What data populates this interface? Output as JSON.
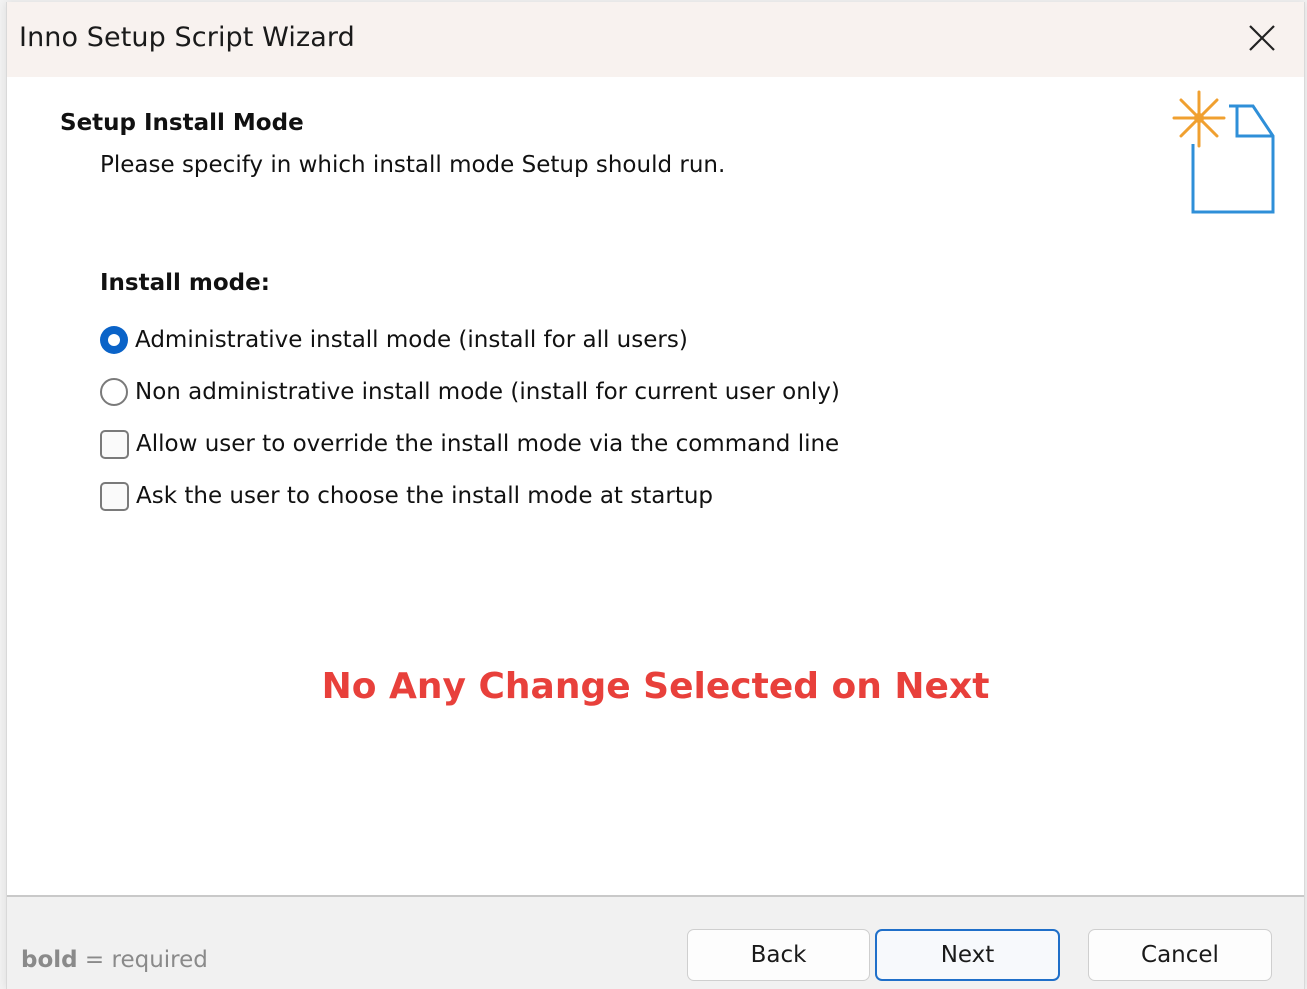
{
  "window": {
    "title": "Inno Setup Script Wizard"
  },
  "page": {
    "heading": "Setup Install Mode",
    "subheading": "Please specify in which install mode Setup should run.",
    "group_label": "Install mode:",
    "options": [
      {
        "type": "radio",
        "label": "Administrative install mode (install for all users)",
        "checked": true
      },
      {
        "type": "radio",
        "label": "Non administrative install mode (install for current user only)",
        "checked": false
      },
      {
        "type": "checkbox",
        "label": "Allow user to override the install mode via the command line",
        "checked": false
      },
      {
        "type": "checkbox",
        "label": "Ask the user to choose the install mode at startup",
        "checked": false
      }
    ],
    "annotation": "No Any Change Selected on Next"
  },
  "footer": {
    "hint_bold": "bold",
    "hint_rest": " = required",
    "buttons": {
      "back": "Back",
      "next": "Next",
      "cancel": "Cancel"
    }
  },
  "colors": {
    "accent": "#0a63c8",
    "annotation": "#e8403b",
    "titlebar": "#f8f2ef",
    "wizard_icon_blue": "#2f8fd8",
    "wizard_icon_star": "#f0a030"
  },
  "icons": {
    "close": "close-icon",
    "wizard_image": "new-document-sparkle-icon"
  }
}
